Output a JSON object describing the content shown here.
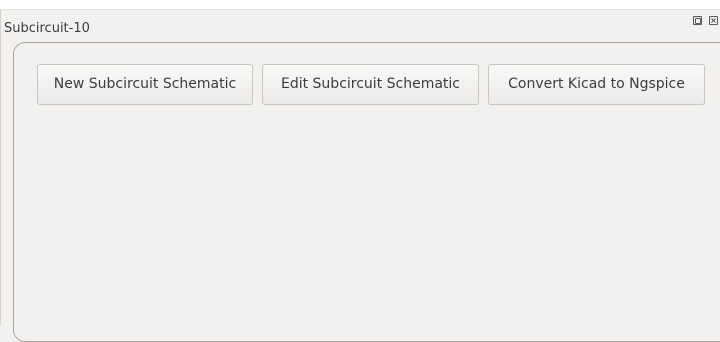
{
  "window": {
    "title": "Subcircuit-10",
    "float_icon": "float-icon",
    "close_icon": "close-icon",
    "close_glyph": "×"
  },
  "buttons": {
    "new_label": "New Subcircuit Schematic",
    "edit_label": "Edit Subcircuit Schematic",
    "convert_label": "Convert Kicad to Ngspice"
  }
}
